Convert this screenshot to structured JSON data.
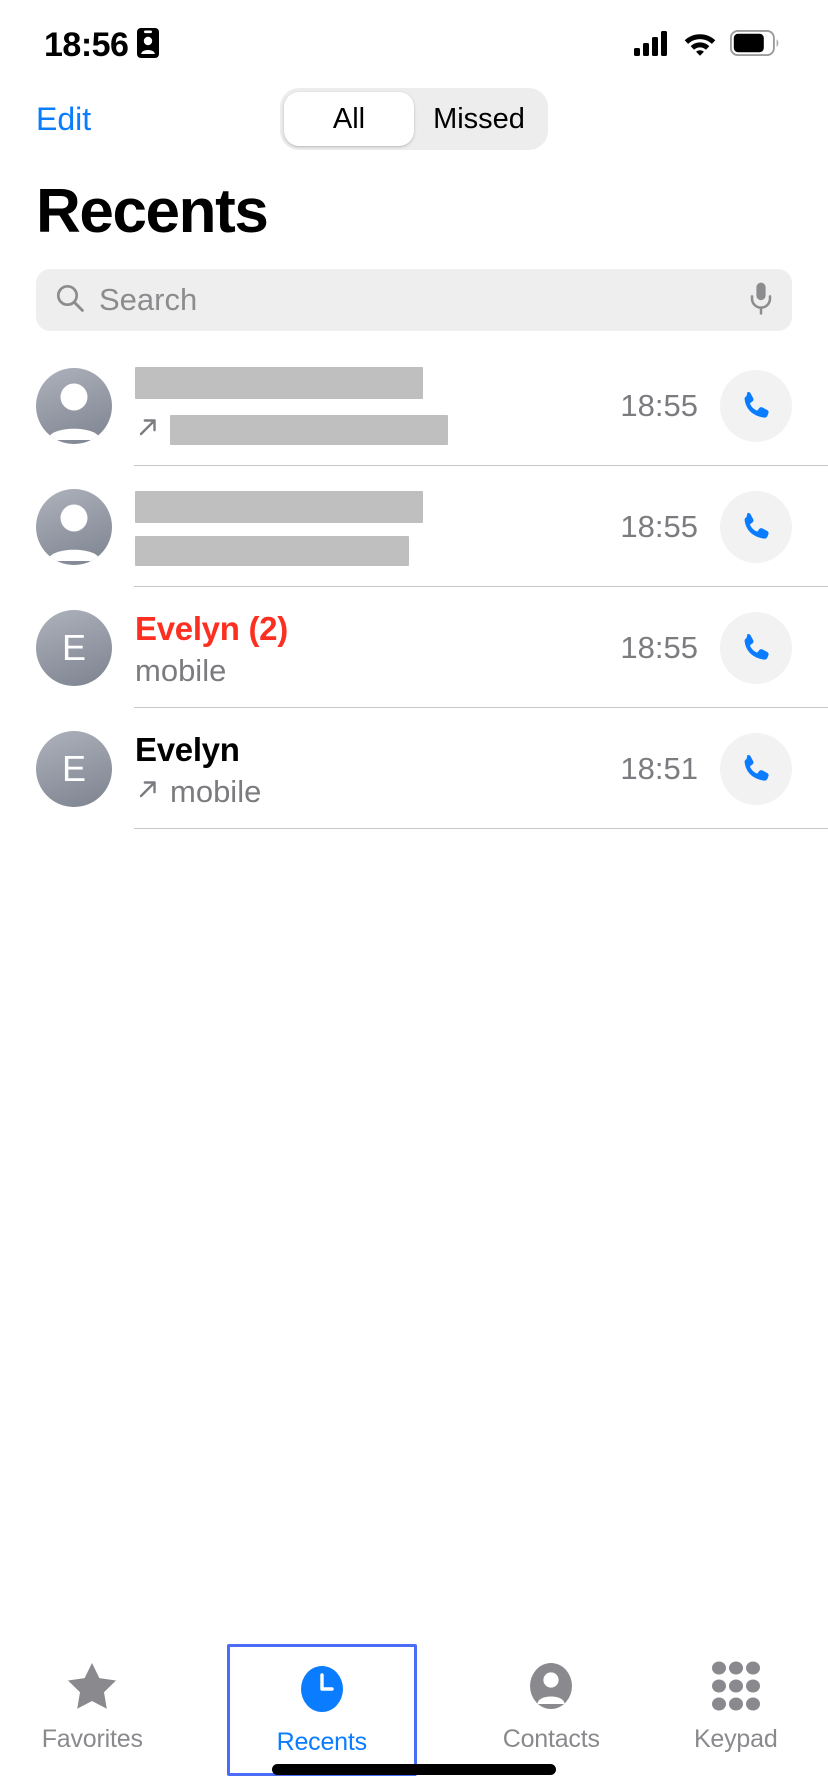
{
  "status_bar": {
    "time": "18:56",
    "badge_icon": "contact-card-icon",
    "signal_icon": "cellular-signal-icon",
    "signal_bars": 4,
    "wifi_icon": "wifi-icon",
    "battery_icon": "battery-icon",
    "battery_level": 75
  },
  "nav": {
    "edit_label": "Edit",
    "segments": [
      {
        "label": "All",
        "selected": true
      },
      {
        "label": "Missed",
        "selected": false
      }
    ]
  },
  "page_title": "Recents",
  "search": {
    "placeholder": "Search",
    "value": "",
    "search_icon": "search-icon",
    "mic_icon": "microphone-icon"
  },
  "calls": [
    {
      "name": "",
      "name_redacted": true,
      "name_redact_width": 288,
      "subtitle": "",
      "subtitle_redacted": true,
      "subtitle_redact_width": 278,
      "missed": false,
      "direction_icon": "outgoing-call-arrow-icon",
      "has_direction_arrow": true,
      "time": "18:55",
      "avatar_type": "person-placeholder",
      "avatar_initial": "",
      "info_icon": "phone-icon"
    },
    {
      "name": "",
      "name_redacted": true,
      "name_redact_width": 288,
      "subtitle": "",
      "subtitle_redacted": true,
      "subtitle_redact_width": 274,
      "missed": true,
      "direction_icon": "",
      "has_direction_arrow": false,
      "time": "18:55",
      "avatar_type": "person-placeholder",
      "avatar_initial": "",
      "info_icon": "phone-icon"
    },
    {
      "name": "Evelyn (2)",
      "name_redacted": false,
      "subtitle": "mobile",
      "subtitle_redacted": false,
      "missed": true,
      "direction_icon": "",
      "has_direction_arrow": false,
      "time": "18:55",
      "avatar_type": "initial",
      "avatar_initial": "E",
      "info_icon": "phone-icon"
    },
    {
      "name": "Evelyn",
      "name_redacted": false,
      "subtitle": "mobile",
      "subtitle_redacted": false,
      "missed": false,
      "direction_icon": "outgoing-call-arrow-icon",
      "has_direction_arrow": true,
      "time": "18:51",
      "avatar_type": "initial",
      "avatar_initial": "E",
      "info_icon": "phone-icon"
    }
  ],
  "tabs": [
    {
      "label": "Favorites",
      "icon": "star-icon",
      "active": false,
      "focused": false
    },
    {
      "label": "Recents",
      "icon": "clock-icon",
      "active": true,
      "focused": true
    },
    {
      "label": "Contacts",
      "icon": "person-circle-icon",
      "active": false,
      "focused": false
    },
    {
      "label": "Keypad",
      "icon": "keypad-grid-icon",
      "active": false,
      "focused": false
    }
  ],
  "colors": {
    "accent_blue": "#0a7cff",
    "missed_red": "#fc2f20",
    "secondary_text": "#7c7c80",
    "separator": "#c8c7cc",
    "search_bg": "#eeeeee",
    "segment_track": "#ededed",
    "focus_ring": "#4a6cf7",
    "redaction": "#bfbfbf"
  }
}
